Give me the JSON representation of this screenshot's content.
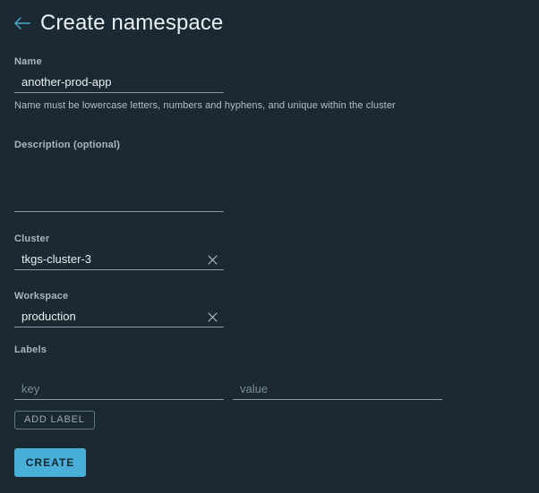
{
  "header": {
    "back_icon": "arrow-left-icon",
    "title": "Create namespace"
  },
  "theme": {
    "background": "#1b2a32",
    "accent": "#49afd9",
    "underline": "#8b99a3",
    "label_color": "#aab6be",
    "value_color": "#eaeff2"
  },
  "form": {
    "name": {
      "label": "Name",
      "value": "another-prod-app",
      "placeholder": "",
      "helper": "Name must be lowercase letters, numbers and hyphens, and unique within the cluster"
    },
    "description": {
      "label": "Description (optional)",
      "value": "",
      "placeholder": ""
    },
    "cluster": {
      "label": "Cluster",
      "value": "tkgs-cluster-3",
      "placeholder": "",
      "clear_icon": "close-icon"
    },
    "workspace": {
      "label": "Workspace",
      "value": "production",
      "placeholder": "",
      "clear_icon": "close-icon"
    },
    "labels": {
      "label": "Labels",
      "key": {
        "value": "",
        "placeholder": "key"
      },
      "value": {
        "value": "",
        "placeholder": "value"
      },
      "add_label_button": "ADD LABEL"
    }
  },
  "actions": {
    "create_button": "CREATE"
  }
}
